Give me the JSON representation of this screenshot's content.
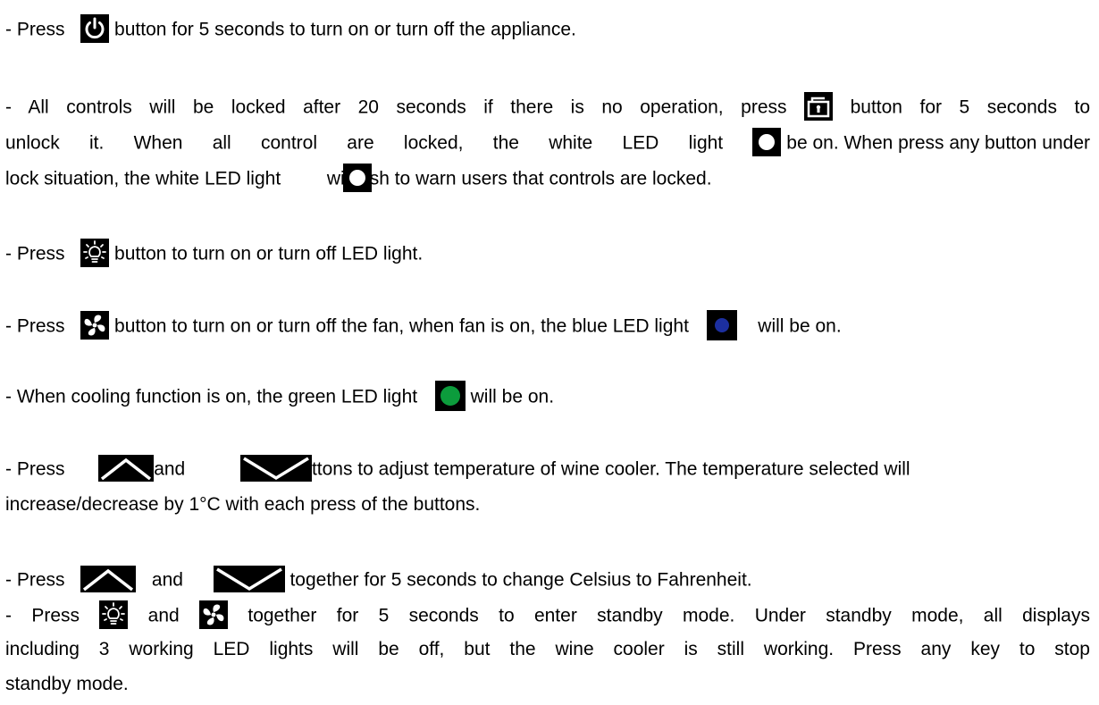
{
  "colors": {
    "icon_bg": "#000000",
    "icon_fg": "#ffffff",
    "blue_led": "#1c2f9f",
    "green_led": "#0c9c3c",
    "fan_blade": "#ffffff"
  },
  "icons": {
    "power": "power-icon",
    "lock": "lock-icon",
    "white_led": "white-led-icon",
    "light": "light-bulb-icon",
    "fan": "fan-icon",
    "blue_led": "blue-led-icon",
    "green_led": "green-led-icon",
    "up": "up-arrow-icon",
    "down": "down-arrow-icon"
  },
  "p1": {
    "a": "- Press",
    "b": "button for 5 seconds to turn on or turn off the appliance."
  },
  "p2": {
    "l1a": "- All controls will be locked after 20 seconds if there is no operation, press",
    "l1b": "button for 5 seconds to",
    "l2a": "unlock it. When all control are locked, the white LED light",
    "l2b": "be on. When press any button under",
    "l3a": "lock situation, the white LED light",
    "l3b": "wi",
    "l3c": "sh to warn users that controls are locked."
  },
  "p3": {
    "a": "- Press",
    "b": "button to turn on or turn off LED light."
  },
  "p4": {
    "a": "- Press",
    "b": "button to turn on or turn off the fan, when fan is on, the blue LED light",
    "c": "will be on."
  },
  "p5": {
    "a": "- When cooling function is on, the green LED light",
    "b": "will be on."
  },
  "p6": {
    "a": "- Press",
    "b": "and",
    "c": "ttons to adjust temperature of wine cooler. The temperature selected will",
    "l2": "increase/decrease by 1°C with each press of the buttons."
  },
  "p7": {
    "a": "- Press",
    "b": "and",
    "c": "together for 5 seconds to change Celsius to Fahrenheit."
  },
  "p8": {
    "a": "- Press",
    "b": "and",
    "c": "together for 5 seconds to enter standby mode. Under standby mode, all displays",
    "l2": "including 3 working LED lights will be off, but the wine cooler is still working. Press any key to stop",
    "l3": "standby mode."
  }
}
